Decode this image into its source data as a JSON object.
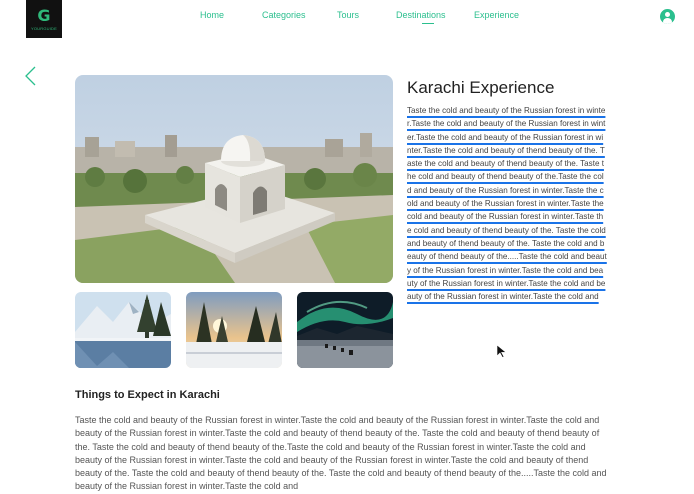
{
  "brand": {
    "mark": "G",
    "name": "YOURGUIDE"
  },
  "nav": {
    "home": "Home",
    "categories": "Categories",
    "tours": "Tours",
    "destinations": "Destinations",
    "experience": "Experience"
  },
  "page": {
    "title": "Karachi Experience",
    "description": "Taste the cold and beauty of the Russian forest in winter.Taste the cold and beauty of the Russian forest in winter.Taste the cold and beauty of the Russian forest in winter.Taste the cold and beauty of thend beauty of the. Taste the cold and beauty of thend beauty of the. Taste the cold and beauty of thend beauty of the.Taste the cold and beauty of the Russian forest in winter.Taste the cold and beauty of the Russian forest in winter.Taste the cold and beauty of the Russian forest in winter.Taste the cold and beauty of thend beauty of the. Taste the cold and beauty of thend beauty of the. Taste the cold and beauty of thend beauty of the.....Taste the cold and beauty of the Russian forest in winter.Taste the cold and beauty of the Russian forest in winter.Taste the cold and beauty of the Russian forest in winter.Taste the cold and",
    "section_title": "Things to Expect in Karachi",
    "section_body": "Taste the cold and beauty of the Russian forest in winter.Taste the cold and beauty of the Russian forest in winter.Taste the cold and beauty of the Russian forest in winter.Taste the cold and beauty of thend beauty of the. Taste the cold and beauty of thend beauty of the. Taste the cold and beauty of thend beauty of the.Taste the cold and beauty of the Russian forest in winter.Taste the cold and beauty of the Russian forest in winter.Taste the cold and beauty of the Russian forest in winter.Taste the cold and beauty of thend beauty of the. Taste the cold and beauty of thend beauty of the. Taste the cold and beauty of thend beauty of the.....Taste the cold and beauty of the Russian forest in winter.Taste the cold and"
  },
  "colors": {
    "accent": "#2bbf8e",
    "underline": "#1a73e8"
  },
  "icons": {
    "back": "chevron-left-icon",
    "profile": "user-circle-icon"
  }
}
